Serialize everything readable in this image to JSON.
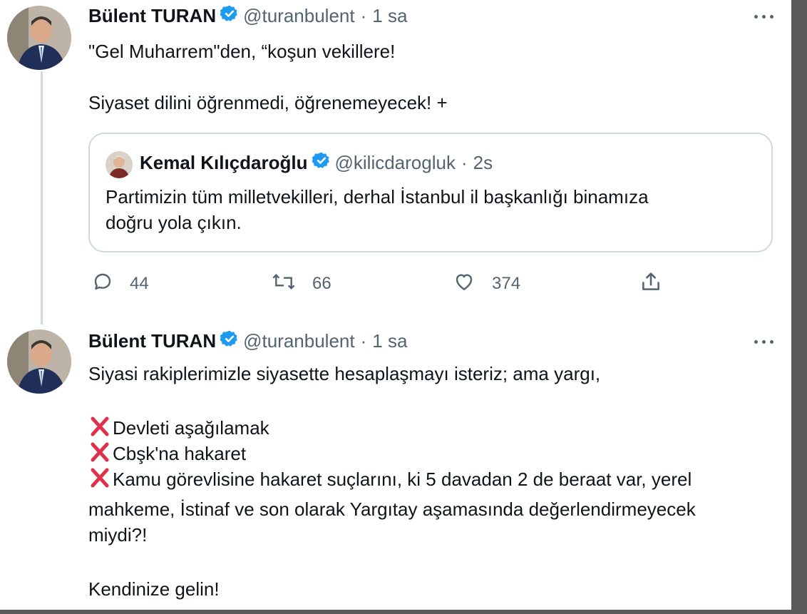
{
  "tweets": [
    {
      "display_name": "Bülent TURAN",
      "handle": "@turanbulent",
      "separator": "·",
      "time": "1 sa",
      "lines": [
        "\"Gel Muharrem\"den, “koşun vekillere!",
        "Siyaset dilini öğrenmedi, öğrenemeyecek! +"
      ],
      "quote": {
        "display_name": "Kemal Kılıçdaroğlu",
        "handle": "@kilicdarogluk",
        "separator": "·",
        "time": "2s",
        "lines": [
          "Partimizin tüm milletvekilleri, derhal İstanbul il başkanlığı binamıza",
          "doğru yola çıkın."
        ]
      },
      "actions": {
        "reply_count": "44",
        "retweet_count": "66",
        "like_count": "374"
      }
    },
    {
      "display_name": "Bülent TURAN",
      "handle": "@turanbulent",
      "separator": "·",
      "time": "1 sa",
      "lines": [
        "Siyasi rakiplerimizle siyasette hesaplaşmayı isteriz; ama yargı,",
        "Devleti aşağılamak",
        "Cbşk'na hakaret",
        "Kamu görevlisine hakaret suçlarını, ki 5 davadan 2 de beraat var, yerel",
        "mahkeme, İstinaf ve son olarak Yargıtay aşamasında değerlendirmeyecek",
        "miydi?!",
        "Kendinize gelin!"
      ]
    }
  ],
  "icons": {
    "verified_badge": "verified-badge-icon",
    "more": "more-icon",
    "reply": "reply-icon",
    "retweet": "retweet-icon",
    "like": "like-icon",
    "share": "share-icon",
    "cross_mark": "cross-mark-icon"
  },
  "colors": {
    "verified_blue": "#1d9bf0",
    "secondary_text": "#536471",
    "cross_red": "#e0304a",
    "border": "#cfd9de"
  }
}
